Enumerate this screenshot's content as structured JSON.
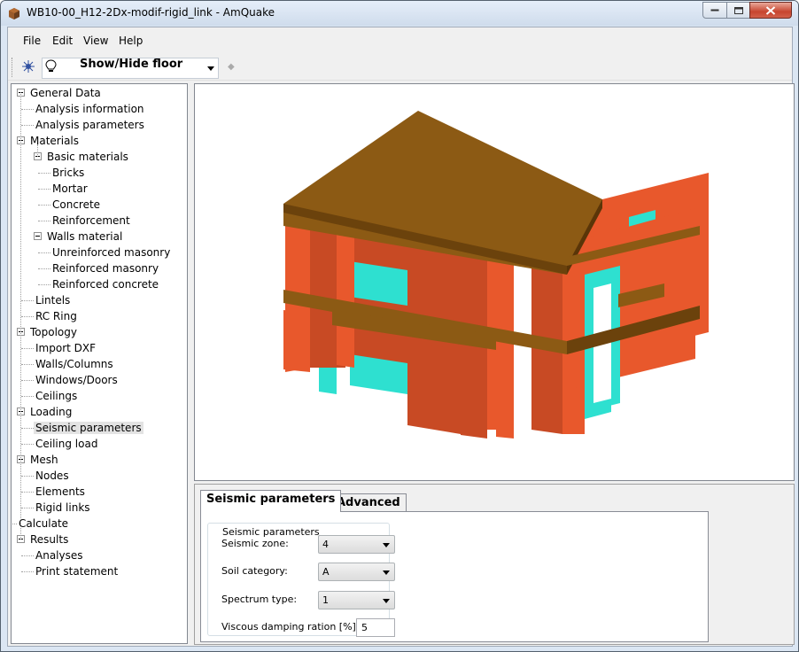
{
  "window": {
    "title": "WB10-00_H12-2Dx-modif-rigid_link - AmQuake"
  },
  "menu": [
    "File",
    "Edit",
    "View",
    "Help"
  ],
  "toolbar": {
    "show_hide_label": "Show/Hide floor"
  },
  "tree": [
    {
      "label": "General Data",
      "level": 0
    },
    {
      "label": "Analysis information",
      "level": 1
    },
    {
      "label": "Analysis parameters",
      "level": 1
    },
    {
      "label": "Materials",
      "level": 0
    },
    {
      "label": "Basic materials",
      "level": 1
    },
    {
      "label": "Bricks",
      "level": 2
    },
    {
      "label": "Mortar",
      "level": 2
    },
    {
      "label": "Concrete",
      "level": 2
    },
    {
      "label": "Reinforcement",
      "level": 2
    },
    {
      "label": "Walls material",
      "level": 1
    },
    {
      "label": "Unreinforced masonry",
      "level": 2
    },
    {
      "label": "Reinforced masonry",
      "level": 2
    },
    {
      "label": "Reinforced concrete",
      "level": 2
    },
    {
      "label": "Lintels",
      "level": 1
    },
    {
      "label": "RC Ring",
      "level": 1
    },
    {
      "label": "Topology",
      "level": 0
    },
    {
      "label": "Import DXF",
      "level": 1
    },
    {
      "label": "Walls/Columns",
      "level": 1
    },
    {
      "label": "Windows/Doors",
      "level": 1
    },
    {
      "label": "Ceilings",
      "level": 1
    },
    {
      "label": "Loading",
      "level": 0
    },
    {
      "label": "Seismic parameters",
      "level": 1,
      "selected": true
    },
    {
      "label": "Ceiling load",
      "level": 1
    },
    {
      "label": "Mesh",
      "level": 0
    },
    {
      "label": "Nodes",
      "level": 1
    },
    {
      "label": "Elements",
      "level": 1
    },
    {
      "label": "Rigid links",
      "level": 1
    },
    {
      "label": "Calculate",
      "level": 0
    },
    {
      "label": "Results",
      "level": 0
    },
    {
      "label": "Analyses",
      "level": 1
    },
    {
      "label": "Print statement",
      "level": 1
    }
  ],
  "tabs": {
    "seismic": "Seismic parameters",
    "advanced": "Advanced"
  },
  "form": {
    "group_title": "Seismic parameters",
    "seismic_zone_label": "Seismic zone:",
    "seismic_zone_value": "4",
    "soil_category_label": "Soil category:",
    "soil_category_value": "A",
    "spectrum_type_label": "Spectrum type:",
    "spectrum_type_value": "1",
    "damping_label": "Viscous damping ration [%]:",
    "damping_value": "5"
  },
  "colors": {
    "wall": "#e8582c",
    "slab": "#8c5a14",
    "window": "#2ee0d0"
  }
}
